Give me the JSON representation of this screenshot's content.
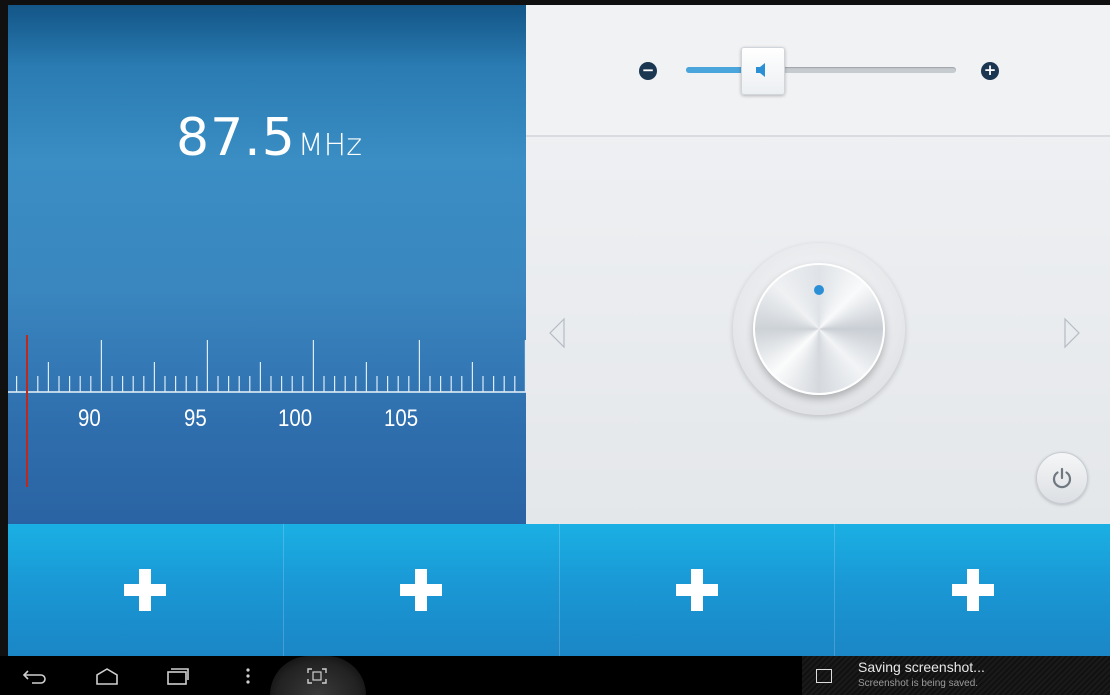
{
  "tuner": {
    "frequency": "87.5",
    "unit": "MHz",
    "scale_labels": [
      "90",
      "95",
      "100",
      "105"
    ]
  },
  "volume": {
    "minus_label": "−",
    "plus_label": "+",
    "level": 0.28
  },
  "controls": {
    "seek_left_icon": "triangle-left-icon",
    "seek_right_icon": "triangle-right-icon",
    "power_icon": "power-icon"
  },
  "presets": [
    {
      "icon": "plus-icon"
    },
    {
      "icon": "plus-icon"
    },
    {
      "icon": "plus-icon"
    },
    {
      "icon": "plus-icon"
    }
  ],
  "navbar": {
    "icons": [
      "back-icon",
      "home-icon",
      "recent-apps-icon",
      "menu-icon",
      "screenshot-icon"
    ]
  },
  "notification": {
    "title": "Saving screenshot...",
    "subtitle": "Screenshot is being saved."
  },
  "colors": {
    "tuner_blue": "#3a8ec4",
    "preset_blue": "#1a98d5",
    "needle_red": "#c0281c",
    "accent_blue": "#2b8fd6"
  }
}
